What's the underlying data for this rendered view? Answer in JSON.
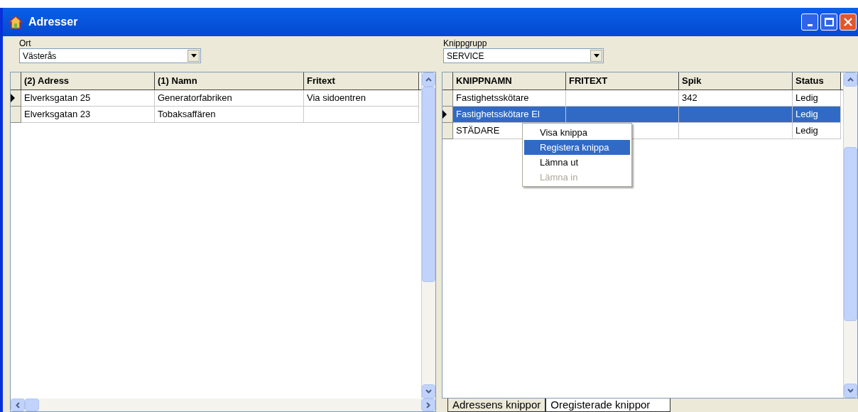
{
  "window": {
    "title": "Adresser"
  },
  "left": {
    "filter": {
      "label": "Ort",
      "value": "Västerås"
    },
    "columns": [
      "(2) Adress",
      "(1) Namn",
      "Fritext"
    ],
    "rows": [
      {
        "cells": [
          "Elverksgatan 25",
          "Generatorfabriken",
          "Via sidoentren"
        ],
        "current": true
      },
      {
        "cells": [
          "Elverksgatan 23",
          "Tobaksaffären",
          null
        ],
        "current": false
      }
    ]
  },
  "right": {
    "filter": {
      "label": "Knippgrupp",
      "value": "SERVICE"
    },
    "columns": [
      "KNIPPNAMN",
      "FRITEXT",
      "Spik",
      "Status"
    ],
    "rows": [
      {
        "cells": [
          "Fastighetsskötare",
          null,
          "342",
          "Ledig"
        ],
        "current": false,
        "selected": false
      },
      {
        "cells": [
          "Fastighetsskötare El",
          null,
          null,
          "Ledig"
        ],
        "current": true,
        "selected": true
      },
      {
        "cells": [
          "STÄDARE",
          null,
          null,
          "Ledig"
        ],
        "current": false,
        "selected": false
      }
    ]
  },
  "context_menu": {
    "items": [
      {
        "label": "Visa knippa",
        "highlighted": false,
        "disabled": false
      },
      {
        "label": "Registera knippa",
        "highlighted": true,
        "disabled": false
      },
      {
        "label": "Lämna ut",
        "highlighted": false,
        "disabled": false
      },
      {
        "label": "Lämna in",
        "highlighted": false,
        "disabled": true
      }
    ]
  },
  "tabs": [
    {
      "label": "Adressens knippor",
      "selected": false
    },
    {
      "label": "Oregisterade knippor",
      "selected": true
    }
  ]
}
